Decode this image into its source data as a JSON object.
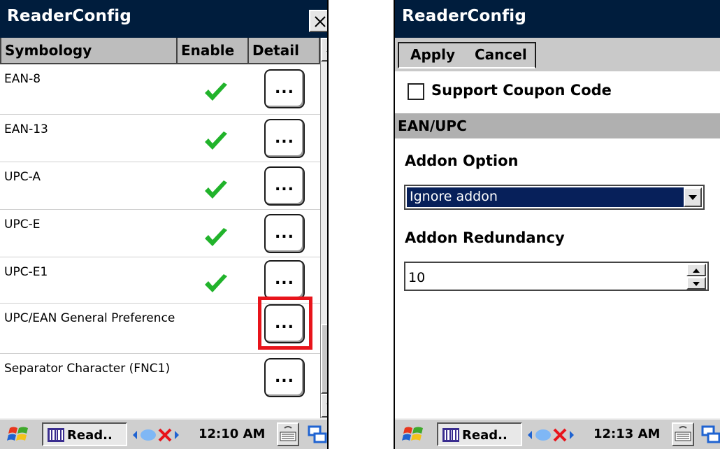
{
  "left": {
    "title": "ReaderConfig",
    "columns": {
      "symbology": "Symbology",
      "enable": "Enable",
      "detail": "Detail"
    },
    "rows": [
      {
        "name": "EAN-8",
        "enabled": true,
        "detail": "..."
      },
      {
        "name": "EAN-13",
        "enabled": true,
        "detail": "..."
      },
      {
        "name": "UPC-A",
        "enabled": true,
        "detail": "..."
      },
      {
        "name": "UPC-E",
        "enabled": true,
        "detail": "..."
      },
      {
        "name": "UPC-E1",
        "enabled": true,
        "detail": "..."
      },
      {
        "name": "UPC/EAN General Preference",
        "enabled": false,
        "detail": "..."
      },
      {
        "name": "Separator Character (FNC1)",
        "enabled": false,
        "detail": "..."
      }
    ],
    "taskbar": {
      "task_label": "Read..",
      "clock": "12:10 AM"
    }
  },
  "right": {
    "title": "ReaderConfig",
    "menu": {
      "apply": "Apply",
      "cancel": "Cancel"
    },
    "coupon_label": "Support Coupon Code",
    "coupon_checked": false,
    "section": "EAN/UPC",
    "addon_option_label": "Addon Option",
    "addon_option_value": "Ignore addon",
    "addon_redundancy_label": "Addon Redundancy",
    "addon_redundancy_value": "10",
    "taskbar": {
      "task_label": "Read..",
      "clock": "12:13 AM"
    }
  },
  "colors": {
    "titlebar": "#001d3d",
    "check": "#21b32b",
    "highlight": "#e8141b",
    "selection": "#07205a"
  }
}
